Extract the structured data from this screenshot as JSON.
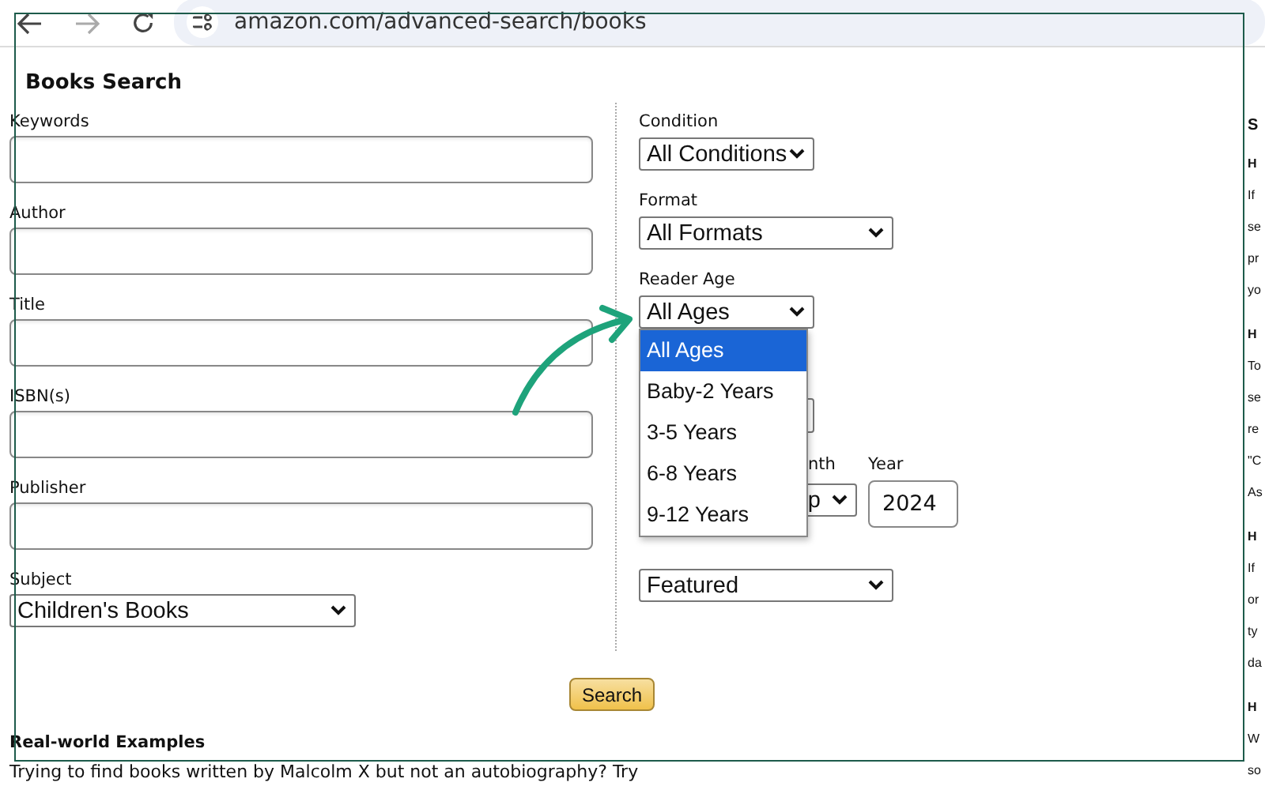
{
  "browser": {
    "url": "amazon.com/advanced-search/books"
  },
  "page_title": "Books Search",
  "left_fields": [
    {
      "label": "Keywords",
      "kind": "text"
    },
    {
      "label": "Author",
      "kind": "text"
    },
    {
      "label": "Title",
      "kind": "text"
    },
    {
      "label": "ISBN(s)",
      "kind": "text"
    },
    {
      "label": "Publisher",
      "kind": "text"
    },
    {
      "label": "Subject",
      "kind": "select",
      "value": "Children's Books"
    }
  ],
  "right_fields": [
    {
      "kind": "select",
      "label": "Condition",
      "value": "All Conditions"
    },
    {
      "kind": "wide_select",
      "label": "Format",
      "value": "All Formats"
    },
    {
      "kind": "select",
      "label": "Reader Age",
      "value": "All Ages",
      "expanded": true
    },
    {
      "kind": "select"
    },
    {
      "kind": "date",
      "month_label": "nth",
      "month_value": "p",
      "year_label": "Year",
      "year_value": "2024"
    },
    {
      "kind": "wide_select",
      "value": "Featured"
    }
  ],
  "dropdown_options": [
    {
      "label": "All Ages",
      "selected": true
    },
    {
      "label": "Baby-2 Years",
      "selected": false
    },
    {
      "label": "3-5 Years",
      "selected": false
    },
    {
      "label": "6-8 Years",
      "selected": false
    },
    {
      "label": "9-12 Years",
      "selected": false
    }
  ],
  "search_button": "Search",
  "examples": {
    "heading": "Real-world Examples",
    "text": "Trying to find books written by Malcolm X but not an autobiography? Try"
  },
  "side_lines": [
    {
      "kind": "title",
      "text": "S"
    },
    {
      "kind": "heading",
      "text": "H"
    },
    {
      "kind": "text",
      "text": "If"
    },
    {
      "kind": "text",
      "text": "se"
    },
    {
      "kind": "text",
      "text": "pr"
    },
    {
      "kind": "text",
      "text": "yo"
    },
    {
      "kind": "heading",
      "text": "H"
    },
    {
      "kind": "text",
      "text": "To"
    },
    {
      "kind": "text",
      "text": "se"
    },
    {
      "kind": "text",
      "text": "re"
    },
    {
      "kind": "text",
      "text": "\"C"
    },
    {
      "kind": "text",
      "text": "As"
    },
    {
      "kind": "heading",
      "text": "H"
    },
    {
      "kind": "text",
      "text": "If"
    },
    {
      "kind": "text",
      "text": "or"
    },
    {
      "kind": "text",
      "text": "ty"
    },
    {
      "kind": "text",
      "text": "da"
    },
    {
      "kind": "heading",
      "text": "H"
    },
    {
      "kind": "text",
      "text": "W"
    },
    {
      "kind": "text",
      "text": "so"
    }
  ]
}
